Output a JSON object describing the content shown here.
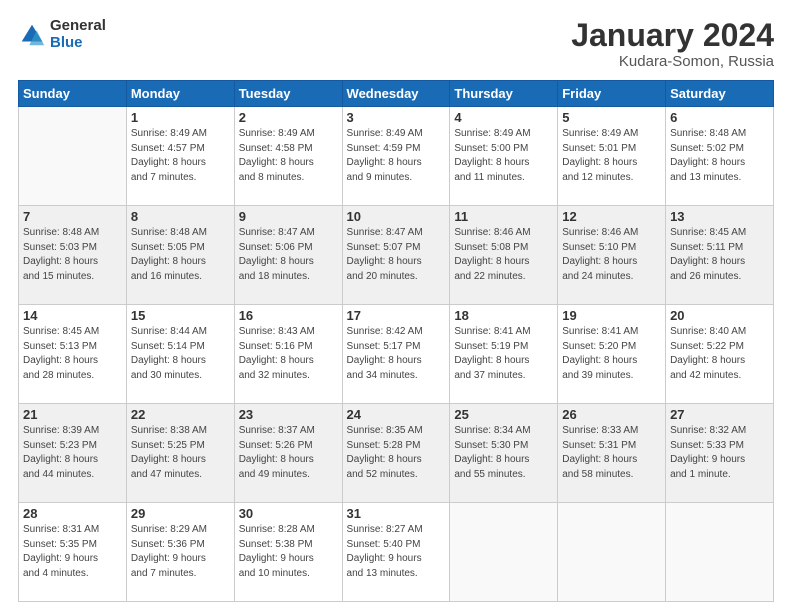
{
  "header": {
    "logo_general": "General",
    "logo_blue": "Blue",
    "title": "January 2024",
    "subtitle": "Kudara-Somon, Russia"
  },
  "days_of_week": [
    "Sunday",
    "Monday",
    "Tuesday",
    "Wednesday",
    "Thursday",
    "Friday",
    "Saturday"
  ],
  "weeks": [
    [
      {
        "day": "",
        "info": ""
      },
      {
        "day": "1",
        "info": "Sunrise: 8:49 AM\nSunset: 4:57 PM\nDaylight: 8 hours\nand 7 minutes."
      },
      {
        "day": "2",
        "info": "Sunrise: 8:49 AM\nSunset: 4:58 PM\nDaylight: 8 hours\nand 8 minutes."
      },
      {
        "day": "3",
        "info": "Sunrise: 8:49 AM\nSunset: 4:59 PM\nDaylight: 8 hours\nand 9 minutes."
      },
      {
        "day": "4",
        "info": "Sunrise: 8:49 AM\nSunset: 5:00 PM\nDaylight: 8 hours\nand 11 minutes."
      },
      {
        "day": "5",
        "info": "Sunrise: 8:49 AM\nSunset: 5:01 PM\nDaylight: 8 hours\nand 12 minutes."
      },
      {
        "day": "6",
        "info": "Sunrise: 8:48 AM\nSunset: 5:02 PM\nDaylight: 8 hours\nand 13 minutes."
      }
    ],
    [
      {
        "day": "7",
        "info": "Sunrise: 8:48 AM\nSunset: 5:03 PM\nDaylight: 8 hours\nand 15 minutes."
      },
      {
        "day": "8",
        "info": "Sunrise: 8:48 AM\nSunset: 5:05 PM\nDaylight: 8 hours\nand 16 minutes."
      },
      {
        "day": "9",
        "info": "Sunrise: 8:47 AM\nSunset: 5:06 PM\nDaylight: 8 hours\nand 18 minutes."
      },
      {
        "day": "10",
        "info": "Sunrise: 8:47 AM\nSunset: 5:07 PM\nDaylight: 8 hours\nand 20 minutes."
      },
      {
        "day": "11",
        "info": "Sunrise: 8:46 AM\nSunset: 5:08 PM\nDaylight: 8 hours\nand 22 minutes."
      },
      {
        "day": "12",
        "info": "Sunrise: 8:46 AM\nSunset: 5:10 PM\nDaylight: 8 hours\nand 24 minutes."
      },
      {
        "day": "13",
        "info": "Sunrise: 8:45 AM\nSunset: 5:11 PM\nDaylight: 8 hours\nand 26 minutes."
      }
    ],
    [
      {
        "day": "14",
        "info": "Sunrise: 8:45 AM\nSunset: 5:13 PM\nDaylight: 8 hours\nand 28 minutes."
      },
      {
        "day": "15",
        "info": "Sunrise: 8:44 AM\nSunset: 5:14 PM\nDaylight: 8 hours\nand 30 minutes."
      },
      {
        "day": "16",
        "info": "Sunrise: 8:43 AM\nSunset: 5:16 PM\nDaylight: 8 hours\nand 32 minutes."
      },
      {
        "day": "17",
        "info": "Sunrise: 8:42 AM\nSunset: 5:17 PM\nDaylight: 8 hours\nand 34 minutes."
      },
      {
        "day": "18",
        "info": "Sunrise: 8:41 AM\nSunset: 5:19 PM\nDaylight: 8 hours\nand 37 minutes."
      },
      {
        "day": "19",
        "info": "Sunrise: 8:41 AM\nSunset: 5:20 PM\nDaylight: 8 hours\nand 39 minutes."
      },
      {
        "day": "20",
        "info": "Sunrise: 8:40 AM\nSunset: 5:22 PM\nDaylight: 8 hours\nand 42 minutes."
      }
    ],
    [
      {
        "day": "21",
        "info": "Sunrise: 8:39 AM\nSunset: 5:23 PM\nDaylight: 8 hours\nand 44 minutes."
      },
      {
        "day": "22",
        "info": "Sunrise: 8:38 AM\nSunset: 5:25 PM\nDaylight: 8 hours\nand 47 minutes."
      },
      {
        "day": "23",
        "info": "Sunrise: 8:37 AM\nSunset: 5:26 PM\nDaylight: 8 hours\nand 49 minutes."
      },
      {
        "day": "24",
        "info": "Sunrise: 8:35 AM\nSunset: 5:28 PM\nDaylight: 8 hours\nand 52 minutes."
      },
      {
        "day": "25",
        "info": "Sunrise: 8:34 AM\nSunset: 5:30 PM\nDaylight: 8 hours\nand 55 minutes."
      },
      {
        "day": "26",
        "info": "Sunrise: 8:33 AM\nSunset: 5:31 PM\nDaylight: 8 hours\nand 58 minutes."
      },
      {
        "day": "27",
        "info": "Sunrise: 8:32 AM\nSunset: 5:33 PM\nDaylight: 9 hours\nand 1 minute."
      }
    ],
    [
      {
        "day": "28",
        "info": "Sunrise: 8:31 AM\nSunset: 5:35 PM\nDaylight: 9 hours\nand 4 minutes."
      },
      {
        "day": "29",
        "info": "Sunrise: 8:29 AM\nSunset: 5:36 PM\nDaylight: 9 hours\nand 7 minutes."
      },
      {
        "day": "30",
        "info": "Sunrise: 8:28 AM\nSunset: 5:38 PM\nDaylight: 9 hours\nand 10 minutes."
      },
      {
        "day": "31",
        "info": "Sunrise: 8:27 AM\nSunset: 5:40 PM\nDaylight: 9 hours\nand 13 minutes."
      },
      {
        "day": "",
        "info": ""
      },
      {
        "day": "",
        "info": ""
      },
      {
        "day": "",
        "info": ""
      }
    ]
  ]
}
